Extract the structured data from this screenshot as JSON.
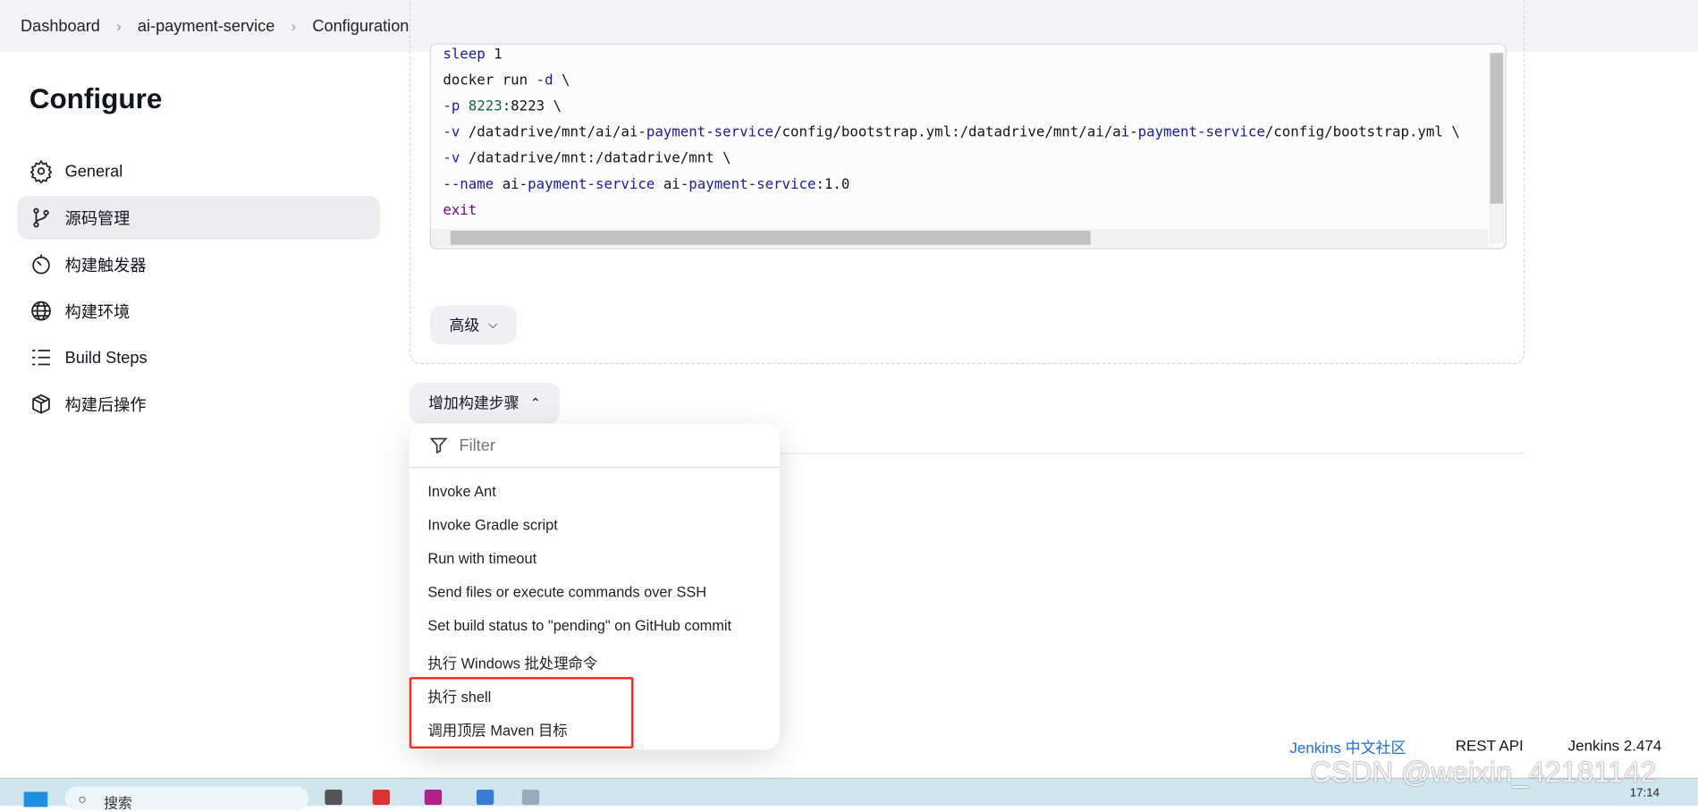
{
  "breadcrumb": [
    "Dashboard",
    "ai-payment-service",
    "Configuration"
  ],
  "page_title": "Configure",
  "sidebar": {
    "items": [
      {
        "label": "General",
        "icon": "gear-icon"
      },
      {
        "label": "源码管理",
        "icon": "branch-icon",
        "active": true
      },
      {
        "label": "构建触发器",
        "icon": "timer-icon"
      },
      {
        "label": "构建环境",
        "icon": "globe-icon"
      },
      {
        "label": "Build Steps",
        "icon": "list-icon"
      },
      {
        "label": "构建后操作",
        "icon": "package-icon"
      }
    ]
  },
  "code": {
    "lines": [
      "sleep 1",
      "docker run -d \\",
      "-p 8223:8223 \\",
      "-v /datadrive/mnt/ai/ai-payment-service/config/bootstrap.yml:/datadrive/mnt/ai/ai-payment-service/config/bootstrap.yml \\",
      "-v /datadrive/mnt:/datadrive/mnt \\",
      "--name ai-payment-service ai-payment-service:1.0",
      "exit"
    ]
  },
  "advanced_label": "高级",
  "add_step_label": "增加构建步骤",
  "menu": {
    "filter_placeholder": "Filter",
    "items": [
      "Invoke Ant",
      "Invoke Gradle script",
      "Run with timeout",
      "Send files or execute commands over SSH",
      "Set build status to \"pending\" on GitHub commit",
      "执行 Windows 批处理命令",
      "执行 shell",
      "调用顶层 Maven 目标"
    ]
  },
  "footer": {
    "community": "Jenkins 中文社区",
    "rest_api": "REST API",
    "version": "Jenkins 2.474"
  },
  "taskbar": {
    "search_placeholder": "搜索",
    "time": "17:14"
  },
  "watermark": "CSDN @weixin_42181142",
  "colors": {
    "highlight_box": "#ff2318",
    "link": "#1a6fe0",
    "keyword": "#1a1aa6"
  }
}
